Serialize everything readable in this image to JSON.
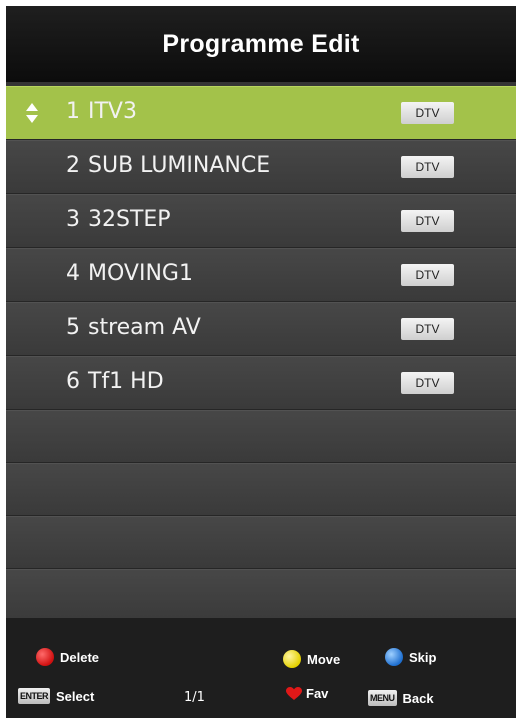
{
  "header": {
    "title": "Programme Edit"
  },
  "programmes": [
    {
      "num": "1",
      "name": "ITV3",
      "type": "DTV",
      "selected": true
    },
    {
      "num": "2",
      "name": "SUB LUMINANCE",
      "type": "DTV",
      "selected": false
    },
    {
      "num": "3",
      "name": "32STEP",
      "type": "DTV",
      "selected": false
    },
    {
      "num": "4",
      "name": "MOVING1",
      "type": "DTV",
      "selected": false
    },
    {
      "num": "5",
      "name": "stream AV",
      "type": "DTV",
      "selected": false
    },
    {
      "num": "6",
      "name": "Tf1 HD",
      "type": "DTV",
      "selected": false
    }
  ],
  "footer": {
    "delete_label": "Delete",
    "move_label": "Move",
    "skip_label": "Skip",
    "enter_key": "ENTER",
    "select_label": "Select",
    "page": "1/1",
    "fav_label": "Fav",
    "menu_key": "MENU",
    "back_label": "Back"
  },
  "colors": {
    "selected_row": "#a3c24a",
    "delete": "#d01010",
    "move": "#e4d100",
    "skip": "#1e6fd0",
    "fav": "#e01818"
  },
  "icons": {
    "selection": "up-down-arrows-icon",
    "delete": "red-button-icon",
    "move": "yellow-button-icon",
    "skip": "blue-button-icon",
    "fav": "heart-icon"
  }
}
